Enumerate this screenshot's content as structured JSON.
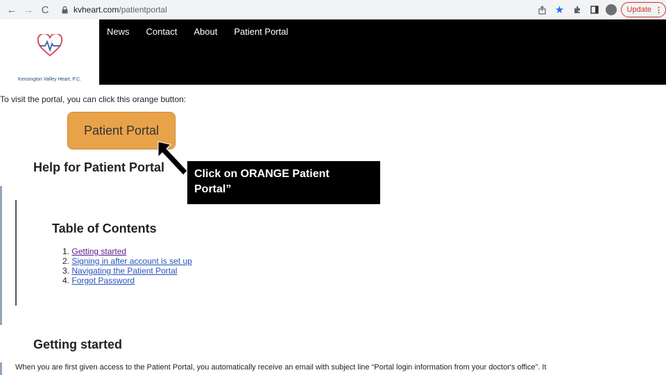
{
  "browser": {
    "nav": {
      "back": "←",
      "forward": "→",
      "reload": "C"
    },
    "url_domain": "kvheart.com",
    "url_path": "/patientportal",
    "update_label": "Update",
    "menu_dots": "⋮"
  },
  "site": {
    "logo_text": "Kensington Valley Heart, P.C.",
    "nav": [
      "News",
      "Contact",
      "About",
      "Patient Portal"
    ]
  },
  "content": {
    "intro": "To visit the portal, you can click this orange button:",
    "portal_button": "Patient Portal",
    "help_heading": "Help for Patient Portal",
    "callout_line1": "Click on ORANGE Patient",
    "callout_line2": "Portal”",
    "toc_heading": "Table of Contents",
    "toc": [
      {
        "num": "1.",
        "label": "Getting started"
      },
      {
        "num": "2.",
        "label": "Signing in after account is set up"
      },
      {
        "num": "3.",
        "label": "Navigating the Patient Portal"
      },
      {
        "num": "4.",
        "label": "Forgot Password"
      }
    ],
    "getting_started_heading": "Getting started",
    "paragraph": "When you are first given access to the Patient Portal, you automatically receive an email with subject line “Portal login information from your doctor's office”. It"
  },
  "colors": {
    "portal_button": "#e8a34a",
    "header_bg": "#000000",
    "link": "#2a52be",
    "visited_link": "#551a8b"
  },
  "icons": [
    "back-arrow-icon",
    "forward-arrow-icon",
    "reload-icon",
    "lock-icon",
    "share-icon",
    "star-icon",
    "extensions-icon",
    "sidebar-icon",
    "profile-icon",
    "heart-logo-icon",
    "pointer-arrow-icon"
  ]
}
